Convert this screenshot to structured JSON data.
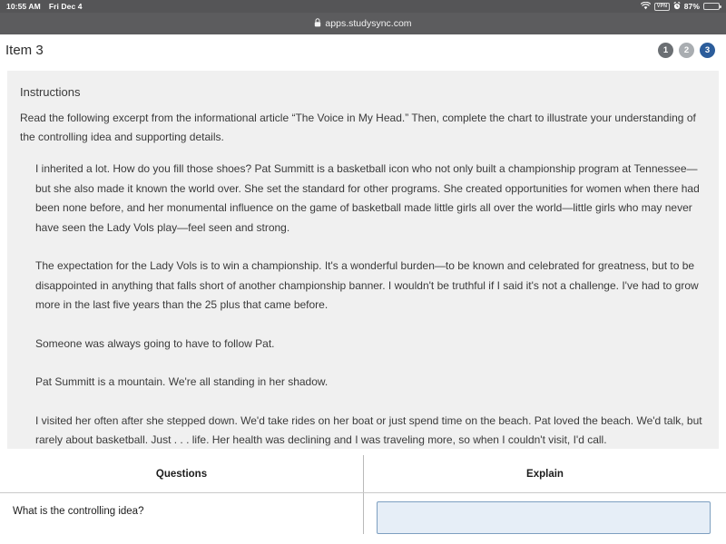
{
  "status_bar": {
    "time": "10:55 AM",
    "date": "Fri Dec 4",
    "wifi_icon": "wifi-icon",
    "vpn_label": "VPN",
    "alarm_icon": "alarm-clock-icon",
    "battery_percent": "87%",
    "battery_level": 87,
    "battery_icon": "battery-icon"
  },
  "browser": {
    "lock_icon": "lock-icon",
    "url": "apps.studysync.com"
  },
  "header": {
    "title": "Item 3",
    "pager": [
      {
        "label": "1",
        "state": "done"
      },
      {
        "label": "2",
        "state": "idle"
      },
      {
        "label": "3",
        "state": "active"
      }
    ],
    "colors": {
      "pager_done": "#6b6f73",
      "pager_idle": "#a9adb1",
      "pager_active": "#2c5d9b"
    }
  },
  "instructions": {
    "heading": "Instructions",
    "body": "Read the following excerpt from the informational article “The Voice in My Head.” Then, complete the chart to illustrate your understanding of the controlling idea and supporting details."
  },
  "excerpt": {
    "paragraphs": [
      "I inherited a lot. How do you fill those shoes? Pat Summitt is a basketball icon who not only built a championship program at Tennessee—but she also made it known the world over. She set the standard for other programs. She created opportunities for women when there had been none before, and her monumental influence on the game of basketball made little girls all over the world—little girls who may never have seen the Lady Vols play—feel seen and strong.",
      "The expectation for the Lady Vols is to win a championship. It's a wonderful burden—to be known and celebrated for greatness, but to be disappointed in anything that falls short of another championship banner. I wouldn't be truthful if I said it's not a challenge. I've had to grow more in the last five years than the 25 plus that came before.",
      "Someone was always going to have to follow Pat.",
      "Pat Summitt is a mountain. We're all standing in her shadow.",
      "I visited her often after she stepped down. We'd take rides on her boat or just spend time on the beach. Pat loved the beach. We'd talk, but rarely about basketball. Just . . . life. Her health was declining and I was traveling more, so when I couldn't visit, I'd call."
    ]
  },
  "chart": {
    "columns": {
      "questions": "Questions",
      "explain": "Explain"
    },
    "rows": [
      {
        "question": "What is the controlling idea?",
        "answer_value": "",
        "answer_placeholder": ""
      }
    ]
  }
}
